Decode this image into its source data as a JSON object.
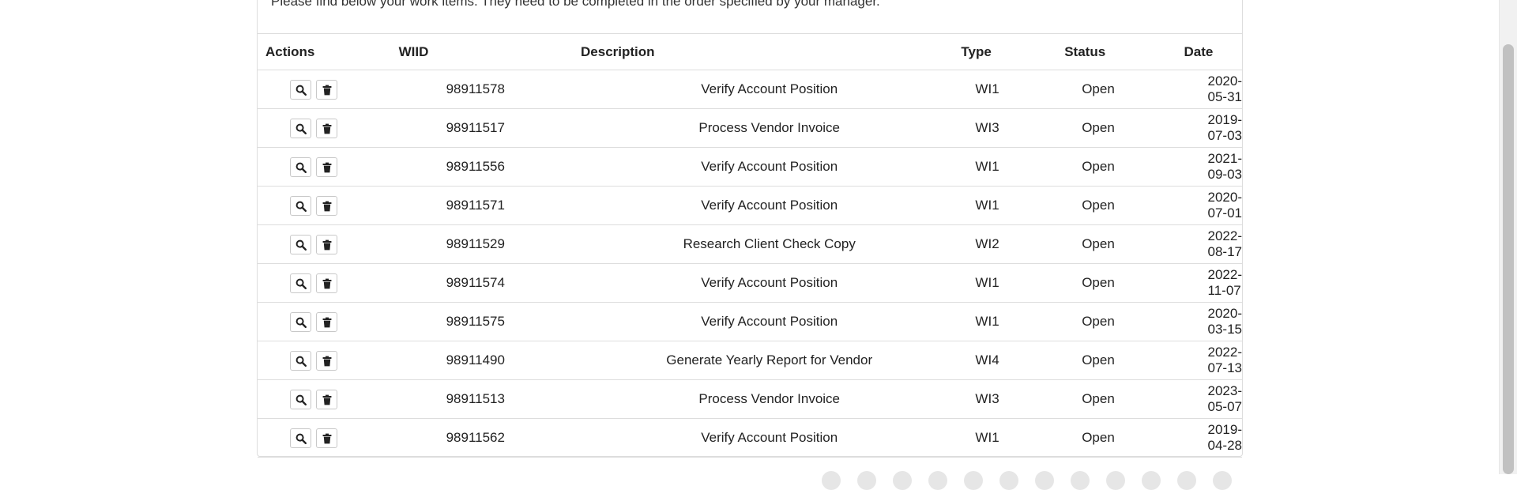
{
  "intro_text": "Please find below your work items. They need to be completed in the order specified by your manager.",
  "table": {
    "headers": {
      "actions": "Actions",
      "wiid": "WIID",
      "description": "Description",
      "type": "Type",
      "status": "Status",
      "date": "Date"
    },
    "rows": [
      {
        "wiid": "98911578",
        "description": "Verify Account Position",
        "type": "WI1",
        "status": "Open",
        "date": "2020-05-31"
      },
      {
        "wiid": "98911517",
        "description": "Process Vendor Invoice",
        "type": "WI3",
        "status": "Open",
        "date": "2019-07-03"
      },
      {
        "wiid": "98911556",
        "description": "Verify Account Position",
        "type": "WI1",
        "status": "Open",
        "date": "2021-09-03"
      },
      {
        "wiid": "98911571",
        "description": "Verify Account Position",
        "type": "WI1",
        "status": "Open",
        "date": "2020-07-01"
      },
      {
        "wiid": "98911529",
        "description": "Research Client Check Copy",
        "type": "WI2",
        "status": "Open",
        "date": "2022-08-17"
      },
      {
        "wiid": "98911574",
        "description": "Verify Account Position",
        "type": "WI1",
        "status": "Open",
        "date": "2022-11-07"
      },
      {
        "wiid": "98911575",
        "description": "Verify Account Position",
        "type": "WI1",
        "status": "Open",
        "date": "2020-03-15"
      },
      {
        "wiid": "98911490",
        "description": "Generate Yearly Report for Vendor",
        "type": "WI4",
        "status": "Open",
        "date": "2022-07-13"
      },
      {
        "wiid": "98911513",
        "description": "Process Vendor Invoice",
        "type": "WI3",
        "status": "Open",
        "date": "2023-05-07"
      },
      {
        "wiid": "98911562",
        "description": "Verify Account Position",
        "type": "WI1",
        "status": "Open",
        "date": "2019-04-28"
      }
    ]
  },
  "row_actions": {
    "view_icon": "search-icon",
    "delete_icon": "trash-icon"
  },
  "colors": {
    "border": "#dddddd",
    "text": "#222222",
    "scrollbar_thumb": "#c1c1c1"
  }
}
